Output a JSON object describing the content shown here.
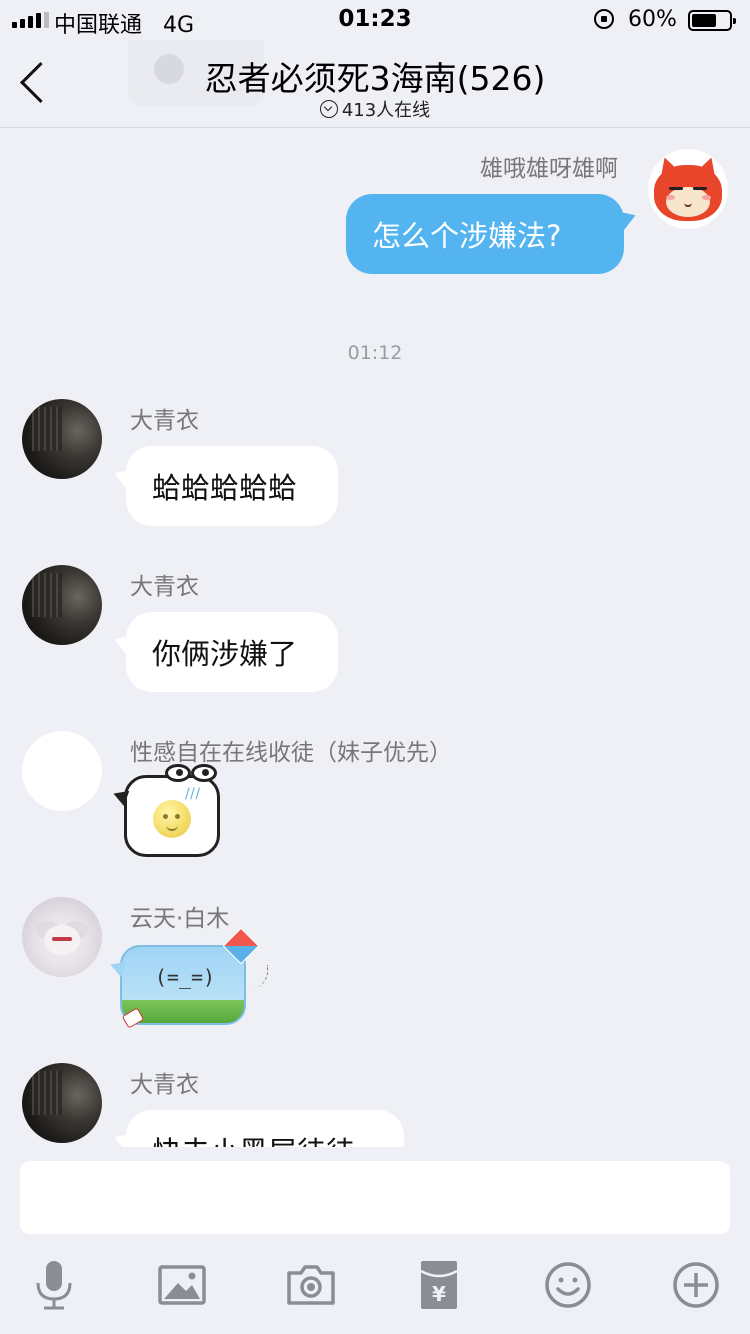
{
  "status_bar": {
    "carrier": "中国联通",
    "network": "4G",
    "time": "01:23",
    "battery_percent": "60%",
    "battery_level": 0.6
  },
  "nav": {
    "title": "忍者必须死3海南(526)",
    "online": "413人在线"
  },
  "messages": [
    {
      "side": "right",
      "sender": "雄哦雄呀雄啊",
      "text": "怎么个涉嫌法?"
    },
    {
      "type": "timestamp",
      "text": "01:12"
    },
    {
      "side": "left",
      "sender": "大青衣",
      "text": "蛤蛤蛤蛤蛤"
    },
    {
      "side": "left",
      "sender": "大青衣",
      "text": "你俩涉嫌了"
    },
    {
      "side": "left",
      "sender": "性感自在在线收徒（妹子优先）",
      "sticker": "moon-face"
    },
    {
      "side": "left",
      "sender": "云天·白木",
      "text": "(=_=)"
    },
    {
      "side": "left",
      "sender": "大青衣",
      "text": "快去小黑屋待待"
    }
  ],
  "icons": {
    "mic": "microphone-icon",
    "image": "image-icon",
    "camera": "camera-icon",
    "red_packet": "red-packet-icon",
    "emoji": "emoji-icon",
    "plus": "plus-icon"
  },
  "colors": {
    "background": "#eef0f5",
    "bubble_self": "#54b4ef",
    "bubble_other": "#ffffff",
    "icon_gray": "#8a8d93"
  }
}
